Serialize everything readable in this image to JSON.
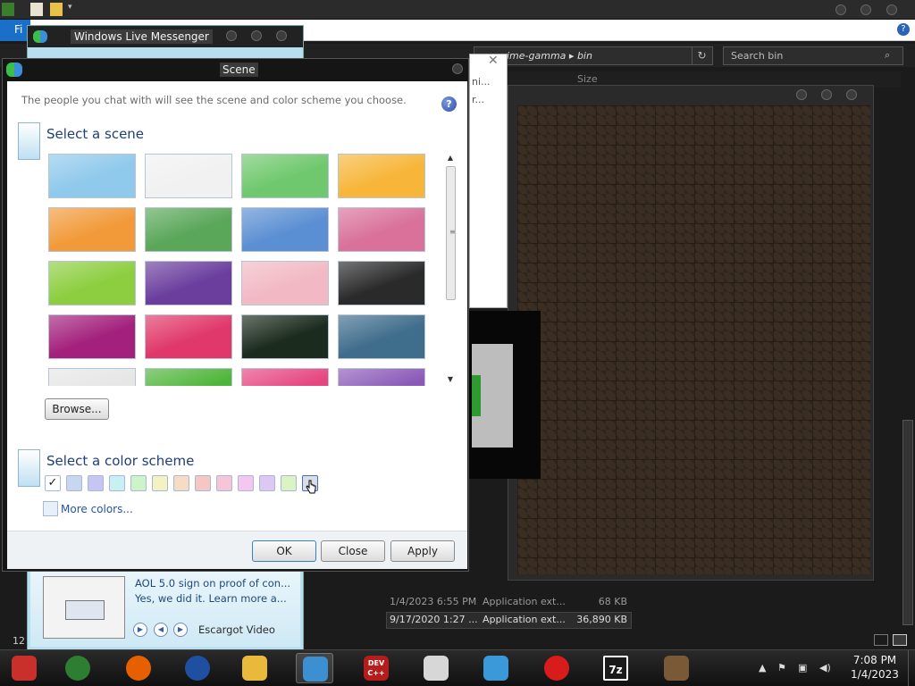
{
  "explorer": {
    "file_tab": "Fi",
    "path_segments": [
      "ime-gamma",
      "bin"
    ],
    "search_placeholder": "Search bin",
    "size_column": "Size",
    "rows": [
      {
        "date": "1/4/2023 6:55 PM",
        "type": "Application ext...",
        "size": "68 KB"
      },
      {
        "date": "9/17/2020 1:27 ...",
        "type": "Application ext...",
        "size": "36,890 KB"
      }
    ],
    "status_text": "12"
  },
  "chat_dialog": {
    "line1": "ni...",
    "line2": "r..."
  },
  "messenger": {
    "title": "Windows Live Messenger",
    "news_headline": "AOL 5.0 sign on proof of con...",
    "news_sub": "Yes, we did it. Learn more a...",
    "news_source": "Escargot Video"
  },
  "scene_dialog": {
    "title": "Scene",
    "description": "The people you chat with will see the scene and color scheme you choose.",
    "select_scene_heading": "Select a scene",
    "browse_label": "Browse...",
    "select_color_heading": "Select a color scheme",
    "more_colors_label": "More colors...",
    "ok_label": "OK",
    "close_label": "Close",
    "apply_label": "Apply",
    "selected_swatch_mark": "✓",
    "scenes": [
      {
        "name": "sky-clouds",
        "color": "#8fc9ec"
      },
      {
        "name": "white-bubbles",
        "color": "#f1f1f1"
      },
      {
        "name": "green-hills-sky",
        "color": "#6fc86d"
      },
      {
        "name": "autumn-tree",
        "color": "#f7b63a"
      },
      {
        "name": "orange-grass",
        "color": "#f29a3a"
      },
      {
        "name": "meadow-character",
        "color": "#5aa75a"
      },
      {
        "name": "blue-mountains",
        "color": "#5b8fd3"
      },
      {
        "name": "pink-hearts",
        "color": "#d9719a"
      },
      {
        "name": "lime-dots",
        "color": "#8cce3f"
      },
      {
        "name": "purple-floral",
        "color": "#6b3e9e"
      },
      {
        "name": "pink-blossom",
        "color": "#f2b9c4"
      },
      {
        "name": "dark-pattern",
        "color": "#2a2a2a"
      },
      {
        "name": "magenta-flower",
        "color": "#a3207c"
      },
      {
        "name": "red-pink-swirl",
        "color": "#e0386a"
      },
      {
        "name": "dark-green-wave",
        "color": "#1b2b1d"
      },
      {
        "name": "sea-rocket",
        "color": "#3f6d8c"
      },
      {
        "name": "white-floral",
        "color": "#e6e6e6"
      },
      {
        "name": "green-bamboo",
        "color": "#4fb53a"
      },
      {
        "name": "colorful-dots",
        "color": "#e6457f"
      },
      {
        "name": "purple-cartoon",
        "color": "#8b5ab8"
      }
    ],
    "color_swatches": [
      "#ffffff",
      "#c8d6f0",
      "#c7c5f3",
      "#c8f0f3",
      "#cdf3c8",
      "#f3f2c0",
      "#f6dcc5",
      "#f5c6c2",
      "#f6c6d8",
      "#f3c7ee",
      "#dcc8f3",
      "#dcf3c4",
      "#d8dde6"
    ]
  },
  "taskbar": {
    "items": [
      {
        "name": "chromium-icon",
        "label": "",
        "color": "#c9302c"
      },
      {
        "name": "chrome-icon",
        "label": "",
        "color": "#2d7d32"
      },
      {
        "name": "firefox-icon",
        "label": "",
        "color": "#e66000"
      },
      {
        "name": "obama-logo-icon",
        "label": "",
        "color": "#1f4fa0"
      },
      {
        "name": "file-explorer-icon",
        "label": "",
        "color": "#e8b93a"
      },
      {
        "name": "messenger-icon",
        "label": "",
        "color": "#3c8fd0"
      },
      {
        "name": "devcpp-icon",
        "label": "DEV C++",
        "color": "#b71c1c"
      },
      {
        "name": "snipping-tool-icon",
        "label": "",
        "color": "#d7d7d7"
      },
      {
        "name": "messenger-people-icon",
        "label": "",
        "color": "#3a9ad9"
      },
      {
        "name": "opera-icon",
        "label": "",
        "color": "#d81b1b"
      },
      {
        "name": "7zip-icon",
        "label": "7z",
        "color": "#1a1a1a"
      },
      {
        "name": "minecraft-icon",
        "label": "",
        "color": "#7a5a36"
      }
    ],
    "time": "7:08 PM",
    "date": "1/4/2023"
  }
}
